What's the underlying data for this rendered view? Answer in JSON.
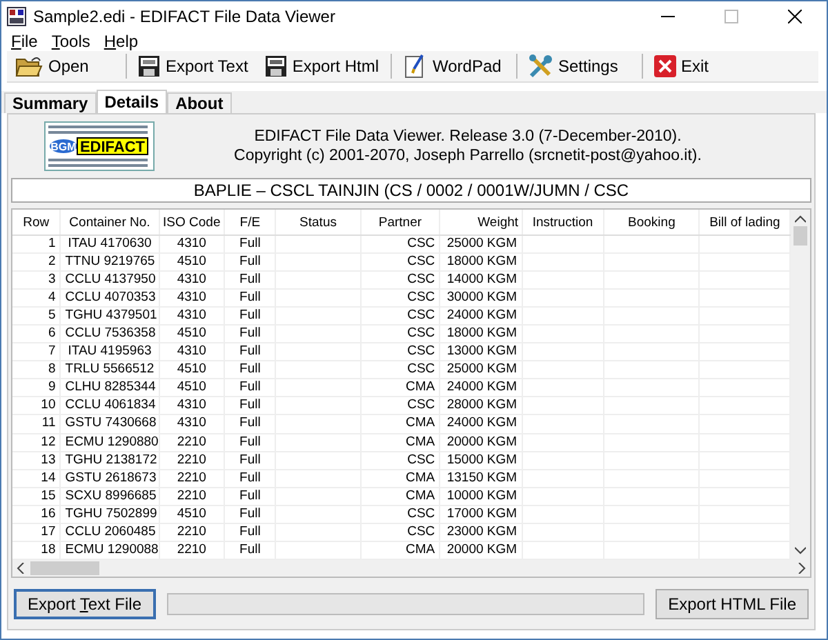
{
  "window": {
    "title": "Sample2.edi - EDIFACT File Data Viewer"
  },
  "menu": [
    {
      "key": "F",
      "rest": "ile"
    },
    {
      "key": "T",
      "rest": "ools"
    },
    {
      "key": "H",
      "rest": "elp"
    }
  ],
  "toolbar": [
    {
      "kind": "open",
      "label": "Open"
    },
    {
      "kind": "csv",
      "label": "Export Text"
    },
    {
      "kind": "htm",
      "label": "Export Html"
    },
    {
      "kind": "wordpad",
      "label": "WordPad"
    },
    {
      "kind": "settings",
      "label": "Settings"
    },
    {
      "kind": "exit",
      "label": "Exit"
    }
  ],
  "tabs": [
    {
      "label": "Summary",
      "selected": false
    },
    {
      "label": "Details",
      "selected": true
    },
    {
      "label": "About",
      "selected": false
    }
  ],
  "logo": {
    "badge": "BGM",
    "text": "EDIFACT"
  },
  "about": [
    "EDIFACT File Data Viewer. Release 3.0 (7-December-2010).",
    "Copyright (c) 2001-2070, Joseph Parrello (srcnetit-post@yahoo.it)."
  ],
  "banner": "BAPLIE – CSCL TAINJIN  (CS / 0002 / 0001W/JUMN / CSC",
  "table": {
    "columns": [
      "Row",
      "Container No.",
      "ISO Code",
      "F/E",
      "Status",
      "Partner",
      "Weight",
      "Instruction",
      "Booking",
      "Bill of lading"
    ],
    "rows": [
      [
        "1",
        "ITAU 4170630",
        "4310",
        "Full",
        "",
        "CSC",
        "25000 KGM",
        "",
        "",
        ""
      ],
      [
        "2",
        "TTNU 9219765",
        "4510",
        "Full",
        "",
        "CSC",
        "18000 KGM",
        "",
        "",
        ""
      ],
      [
        "3",
        "CCLU 4137950",
        "4310",
        "Full",
        "",
        "CSC",
        "14000 KGM",
        "",
        "",
        ""
      ],
      [
        "4",
        "CCLU 4070353",
        "4310",
        "Full",
        "",
        "CSC",
        "30000 KGM",
        "",
        "",
        ""
      ],
      [
        "5",
        "TGHU 4379501",
        "4310",
        "Full",
        "",
        "CSC",
        "24000 KGM",
        "",
        "",
        ""
      ],
      [
        "6",
        "CCLU 7536358",
        "4510",
        "Full",
        "",
        "CSC",
        "18000 KGM",
        "",
        "",
        ""
      ],
      [
        "7",
        "ITAU 4195963",
        "4310",
        "Full",
        "",
        "CSC",
        "13000 KGM",
        "",
        "",
        ""
      ],
      [
        "8",
        "TRLU 5566512",
        "4510",
        "Full",
        "",
        "CSC",
        "25000 KGM",
        "",
        "",
        ""
      ],
      [
        "9",
        "CLHU 8285344",
        "4510",
        "Full",
        "",
        "CMA",
        "24000 KGM",
        "",
        "",
        ""
      ],
      [
        "10",
        "CCLU 4061834",
        "4310",
        "Full",
        "",
        "CSC",
        "28000 KGM",
        "",
        "",
        ""
      ],
      [
        "11",
        "GSTU 7430668",
        "4310",
        "Full",
        "",
        "CMA",
        "24000 KGM",
        "",
        "",
        ""
      ],
      [
        "12",
        "ECMU 1290880",
        "2210",
        "Full",
        "",
        "CMA",
        "20000 KGM",
        "",
        "",
        ""
      ],
      [
        "13",
        "TGHU 2138172",
        "2210",
        "Full",
        "",
        "CSC",
        "15000 KGM",
        "",
        "",
        ""
      ],
      [
        "14",
        "GSTU 2618673",
        "2210",
        "Full",
        "",
        "CMA",
        "13150 KGM",
        "",
        "",
        ""
      ],
      [
        "15",
        "SCXU 8996685",
        "2210",
        "Full",
        "",
        "CMA",
        "10000 KGM",
        "",
        "",
        ""
      ],
      [
        "16",
        "TGHU 7502899",
        "4510",
        "Full",
        "",
        "CSC",
        "17000 KGM",
        "",
        "",
        ""
      ],
      [
        "17",
        "CCLU 2060485",
        "2210",
        "Full",
        "",
        "CSC",
        "23000 KGM",
        "",
        "",
        ""
      ],
      [
        "18",
        "ECMU 1290088",
        "2210",
        "Full",
        "",
        "CMA",
        "20000 KGM",
        "",
        "",
        ""
      ]
    ]
  },
  "buttons": [
    {
      "before": "Export ",
      "key": "T",
      "rest": "ext File",
      "selected": true
    },
    {
      "before": "Export HTML File",
      "selected": false
    }
  ],
  "progress": {
    "level": 0
  }
}
